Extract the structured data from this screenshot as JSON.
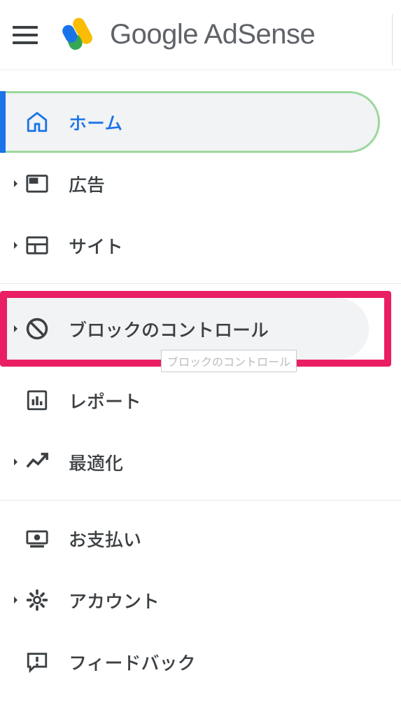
{
  "header": {
    "brand_google": "Google",
    "brand_adsense": " AdSense"
  },
  "nav": {
    "home": "ホーム",
    "ads": "広告",
    "sites": "サイト",
    "blocking": "ブロックのコントロール",
    "reports": "レポート",
    "optimize": "最適化",
    "payments": "お支払い",
    "account": "アカウント",
    "feedback": "フィードバック"
  },
  "tooltip": {
    "blocking": "ブロックのコントロール"
  }
}
